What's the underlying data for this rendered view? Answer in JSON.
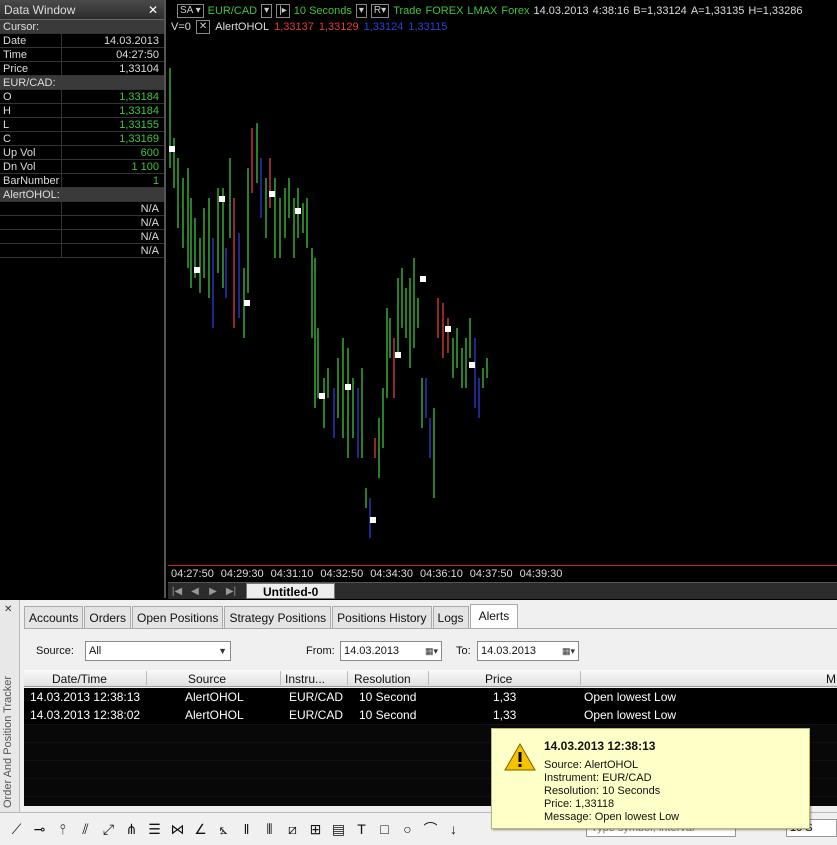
{
  "data_window": {
    "title": "Data Window",
    "cursor_header": "Cursor:",
    "cursor_rows": [
      {
        "key": "Date",
        "value": "14.03.2013"
      },
      {
        "key": "Time",
        "value": "04:27:50"
      },
      {
        "key": "Price",
        "value": "1,33104"
      }
    ],
    "symbol_header": "EUR/CAD:",
    "symbol_rows": [
      {
        "key": "O",
        "value": "1,33184"
      },
      {
        "key": "H",
        "value": "1,33184"
      },
      {
        "key": "L",
        "value": "1,33155"
      },
      {
        "key": "C",
        "value": "1,33169"
      },
      {
        "key": "Up Vol",
        "value": "600"
      },
      {
        "key": "Dn Vol",
        "value": "1 100"
      },
      {
        "key": "BarNumber",
        "value": "1"
      }
    ],
    "alert_header": "AlertOHOL:",
    "alert_rows": [
      "N/A",
      "N/A",
      "N/A",
      "N/A"
    ]
  },
  "chart_toolbar": {
    "sa_button": "SA",
    "symbol": "EUR/CAD",
    "interval": "10 Seconds",
    "r_button": "R",
    "trade_label": "Trade",
    "market": "FOREX",
    "broker": "LMAX",
    "asset": "Forex",
    "date": "14.03.2013",
    "time": "4:38:16",
    "bid": "B=1,33124",
    "ask": "A=1,33135",
    "high": "H=1,33286",
    "volume_label": "V=0",
    "indicator_name": "AlertOHOL",
    "ind_values": [
      "1,33137",
      "1,33129",
      "1,33124",
      "1,33115"
    ]
  },
  "chart_data": {
    "type": "ohlc",
    "x": [
      "04:27:50",
      "04:29:30",
      "04:31:10",
      "04:32:50",
      "04:34:30",
      "04:36:10",
      "04:37:50",
      "04:39:30"
    ],
    "colors": {
      "up": "#3ec43e",
      "down": "#e23c3c",
      "neutral": "#2c3fd6",
      "marker": "#ffffff"
    }
  },
  "sheet_tab": "Untitled-0",
  "order_tracker": {
    "side_label": "Order And Position Tracker",
    "tabs": [
      "Accounts",
      "Orders",
      "Open Positions",
      "Strategy Positions",
      "Positions History",
      "Logs",
      "Alerts"
    ],
    "active_tab": "Alerts",
    "source_label": "Source:",
    "source_value": "All",
    "from_label": "From:",
    "from_value": "14.03.2013",
    "to_label": "To:",
    "to_value": "14.03.2013",
    "columns": [
      "Date/Time",
      "Source",
      "Instru...",
      "Resolution",
      "Price",
      "M"
    ],
    "rows": [
      {
        "datetime": "14.03.2013 12:38:13",
        "source": "AlertOHOL",
        "instrument": "EUR/CAD",
        "resolution": "10 Second",
        "price": "1,33",
        "message": "Open lowest Low"
      },
      {
        "datetime": "14.03.2013 12:38:02",
        "source": "AlertOHOL",
        "instrument": "EUR/CAD",
        "resolution": "10 Second",
        "price": "1,33",
        "message": "Open lowest Low"
      }
    ]
  },
  "popup": {
    "title": "14.03.2013 12:38:13",
    "lines": [
      "Source: AlertOHOL",
      "Instrument: EUR/CAD",
      "Resolution: 10 Seconds",
      "Price: 1,33118",
      "Message: Open lowest Low"
    ]
  },
  "bottom_toolbar": {
    "symbol_placeholder": "Type symbol, interval",
    "resolution_value": "10 S"
  }
}
